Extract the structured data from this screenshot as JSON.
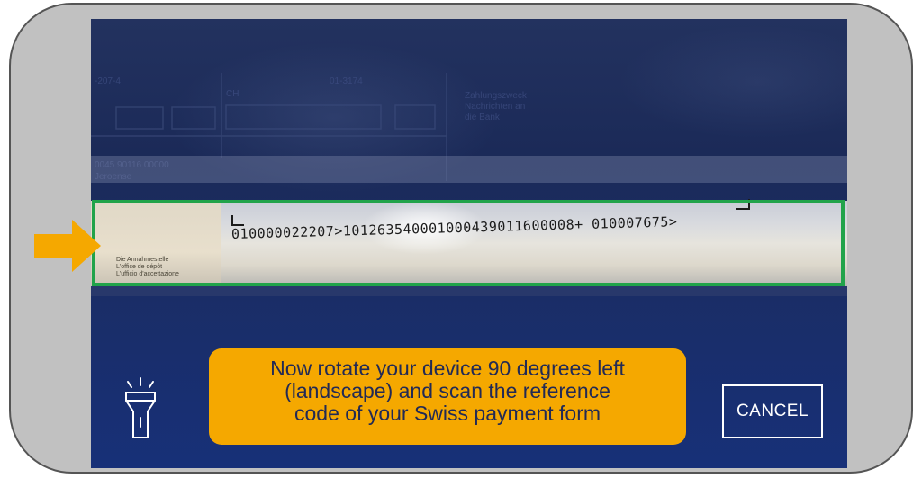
{
  "scanner": {
    "reference_code": "010000022207>101263540001000439011600008+ 010007675>",
    "slip_small_print": [
      "Die Annahmestelle",
      "L'office de dépôt",
      "L'ufficio d'accettazione"
    ],
    "instruction_lines": [
      "Now rotate your device 90 degrees left",
      "(landscape) and scan the reference",
      "code of your Swiss payment form"
    ],
    "cancel_label": "CANCEL"
  },
  "colors": {
    "frame_background": "#c1c1c1",
    "camera_background": "#1b2a58",
    "scan_frame": "#21a34a",
    "arrow": "#f5a800",
    "instruction_bg": "#f5a800",
    "instruction_text": "#222a55"
  },
  "icons": {
    "flashlight": "flashlight-icon",
    "arrow": "arrow-right-icon"
  }
}
